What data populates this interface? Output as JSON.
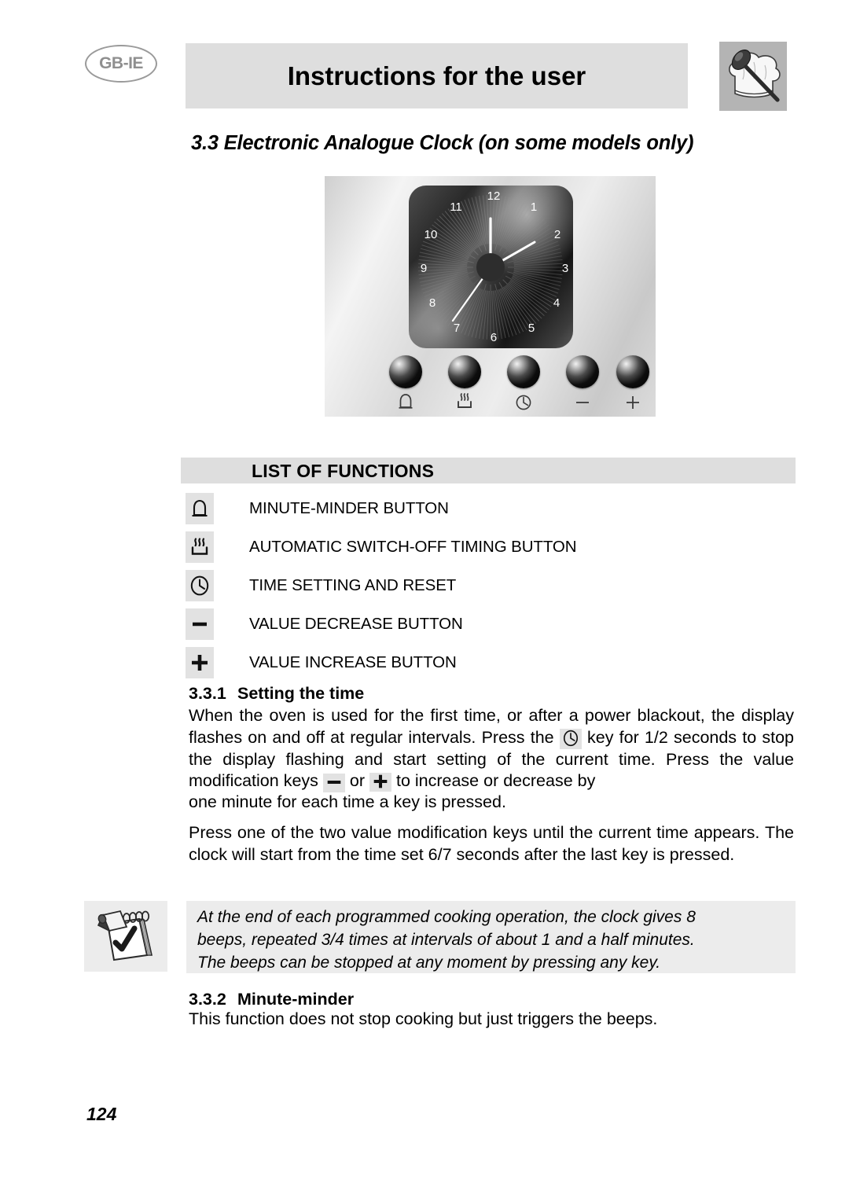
{
  "header": {
    "language_badge": "GB-IE",
    "title": "Instructions for the user",
    "chef_icon": "chef-hat-spoon-icon"
  },
  "section": {
    "heading": "3.3 Electronic Analogue Clock (on some models only)"
  },
  "clock_panel": {
    "numerals": [
      "1",
      "2",
      "3",
      "4",
      "5",
      "6",
      "7",
      "8",
      "9",
      "10",
      "11",
      "12"
    ],
    "hands": {
      "hour": "2",
      "minute": "12",
      "second": "7"
    },
    "buttons": [
      {
        "name": "minute-minder",
        "icon": "bell-icon"
      },
      {
        "name": "auto-switch-off",
        "icon": "heating-element-icon"
      },
      {
        "name": "time-setting",
        "icon": "clock-icon"
      },
      {
        "name": "value-decrease",
        "icon": "minus-icon"
      },
      {
        "name": "value-increase",
        "icon": "plus-icon"
      }
    ]
  },
  "functions": {
    "bar_title": "LIST OF FUNCTIONS",
    "items": [
      {
        "icon": "bell-icon",
        "label": "MINUTE-MINDER BUTTON"
      },
      {
        "icon": "heating-element-icon",
        "label": "AUTOMATIC SWITCH-OFF TIMING BUTTON"
      },
      {
        "icon": "clock-icon",
        "label": "TIME SETTING AND RESET"
      },
      {
        "icon": "minus-icon",
        "label": "VALUE DECREASE BUTTON"
      },
      {
        "icon": "plus-icon",
        "label": "VALUE INCREASE BUTTON"
      }
    ]
  },
  "subsections": {
    "setting_time": {
      "number": "3.3.1",
      "title": "Setting the time"
    },
    "minute_minder": {
      "number": "3.3.2",
      "title": "Minute-minder"
    }
  },
  "body": {
    "p1_part1": "When the oven is used for the first time, or after a power blackout, the display flashes on and off at regular intervals.  Press the",
    "p1_part2": "key for 1/2 seconds to stop the display flashing and start setting of the current time. Press the value modification keys",
    "p1_or": "or",
    "p1_part3": "to increase or decrease by",
    "p2": "one minute for each time a key is pressed.",
    "p3": "Press one of the two value modification keys until the current time appears. The clock will start from the time set 6/7 seconds after the last key is pressed.",
    "p4": "This function does not stop cooking but just triggers the beeps."
  },
  "note": {
    "icon": "notepad-pencil-check-icon",
    "line1": "At the end of each programmed cooking operation, the clock gives 8",
    "line2": "beeps, repeated 3/4 times at intervals of about 1 and a half minutes.",
    "line3": "The beeps can be stopped at any moment by pressing any key."
  },
  "footer": {
    "page_number": "124"
  },
  "colors": {
    "bar_gray": "#dedede",
    "note_gray": "#ececec",
    "icon_gray": "#e2e2e2",
    "badge_gray": "#8f8f8f"
  }
}
